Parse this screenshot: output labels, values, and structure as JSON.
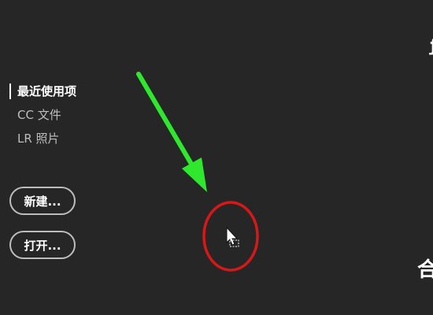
{
  "sidebar": {
    "items": [
      {
        "label": "最近使用项",
        "active": true
      },
      {
        "label": "CC 文件",
        "active": false
      },
      {
        "label": "LR 照片",
        "active": false
      }
    ]
  },
  "actions": {
    "new_label": "新建...",
    "open_label": "打开..."
  },
  "edge_text": {
    "top": "ƒ",
    "bottom": "合"
  },
  "colors": {
    "background": "#262626",
    "text": "#d4d4d4",
    "active_text": "#ffffff",
    "arrow": "#2ee82e",
    "highlight_circle": "#d81818"
  },
  "icons": {
    "cursor": "mouse-pointer-with-marquee-icon",
    "annotation_arrow": "green-arrow-icon",
    "annotation_circle": "red-circle-icon"
  }
}
